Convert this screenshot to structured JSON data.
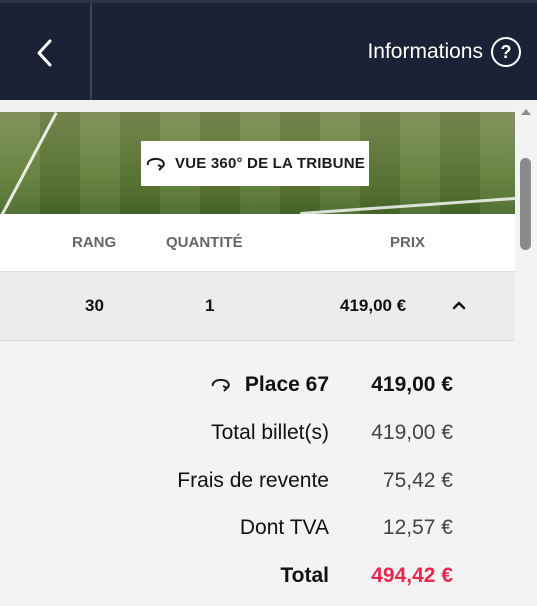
{
  "header": {
    "back_icon": "chevron-left-icon",
    "info_label": "Informations",
    "info_icon": "question-circle-icon",
    "info_glyph": "?"
  },
  "stadium": {
    "view_button_label": "VUE 360° DE LA TRIBUNE",
    "view_icon": "rotate-360-icon"
  },
  "table": {
    "headers": {
      "rang": "RANG",
      "quantite": "QUANTITÉ",
      "prix": "PRIX"
    },
    "row": {
      "rang": "30",
      "quantite": "1",
      "prix": "419,00 €",
      "toggle_icon": "chevron-up-icon"
    }
  },
  "details": {
    "place_label": "Place 67",
    "place_price": "419,00 €",
    "total_billets_label": "Total billet(s)",
    "total_billets_value": "419,00 €",
    "frais_label": "Frais de revente",
    "frais_value": "75,42 €",
    "tva_label": "Dont TVA",
    "tva_value": "12,57 €",
    "total_label": "Total",
    "total_value": "494,42 €"
  },
  "colors": {
    "topbar": "#1b2235",
    "total_accent": "#e8264f"
  }
}
